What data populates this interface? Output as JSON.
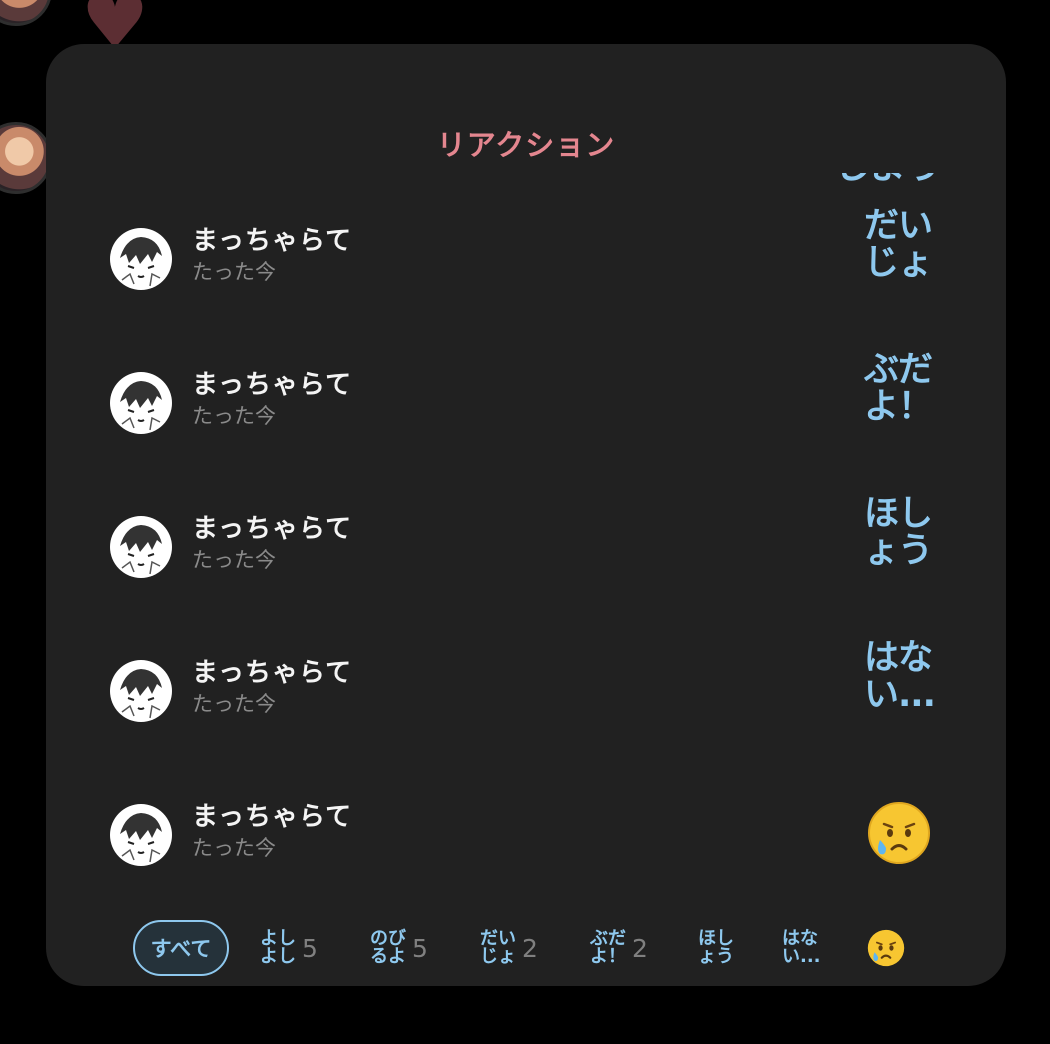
{
  "sheet": {
    "title": "リアクション"
  },
  "list": {
    "partial_top_reaction": "しよう",
    "rows": [
      {
        "user": "まっちゃらて",
        "time": "たった今",
        "reaction": [
          "だい",
          "じょ"
        ]
      },
      {
        "user": "まっちゃらて",
        "time": "たった今",
        "reaction": [
          "ぶだ",
          "よ！"
        ]
      },
      {
        "user": "まっちゃらて",
        "time": "たった今",
        "reaction": [
          "ほし",
          "ょう"
        ]
      },
      {
        "user": "まっちゃらて",
        "time": "たった今",
        "reaction": [
          "はな",
          "い..."
        ]
      },
      {
        "user": "まっちゃらて",
        "time": "たった今",
        "reaction_icon": "crying-face-emoji"
      }
    ]
  },
  "tabs": {
    "all_label": "すべて",
    "items": [
      {
        "lines": [
          "よし",
          "よし"
        ],
        "count": "5"
      },
      {
        "lines": [
          "のび",
          "るよ"
        ],
        "count": "5"
      },
      {
        "lines": [
          "だい",
          "じょ"
        ],
        "count": "2"
      },
      {
        "lines": [
          "ぶだ",
          "よ！"
        ],
        "count": "2"
      },
      {
        "lines": [
          "ほし",
          "ょう"
        ],
        "count": ""
      },
      {
        "lines": [
          "はな",
          "い..."
        ],
        "count": ""
      },
      {
        "icon": "crying-face-emoji",
        "count": ""
      }
    ]
  },
  "colors": {
    "accent_pink": "#e4868f",
    "accent_blue": "#8ec8ee",
    "sheet_bg": "#212121"
  }
}
